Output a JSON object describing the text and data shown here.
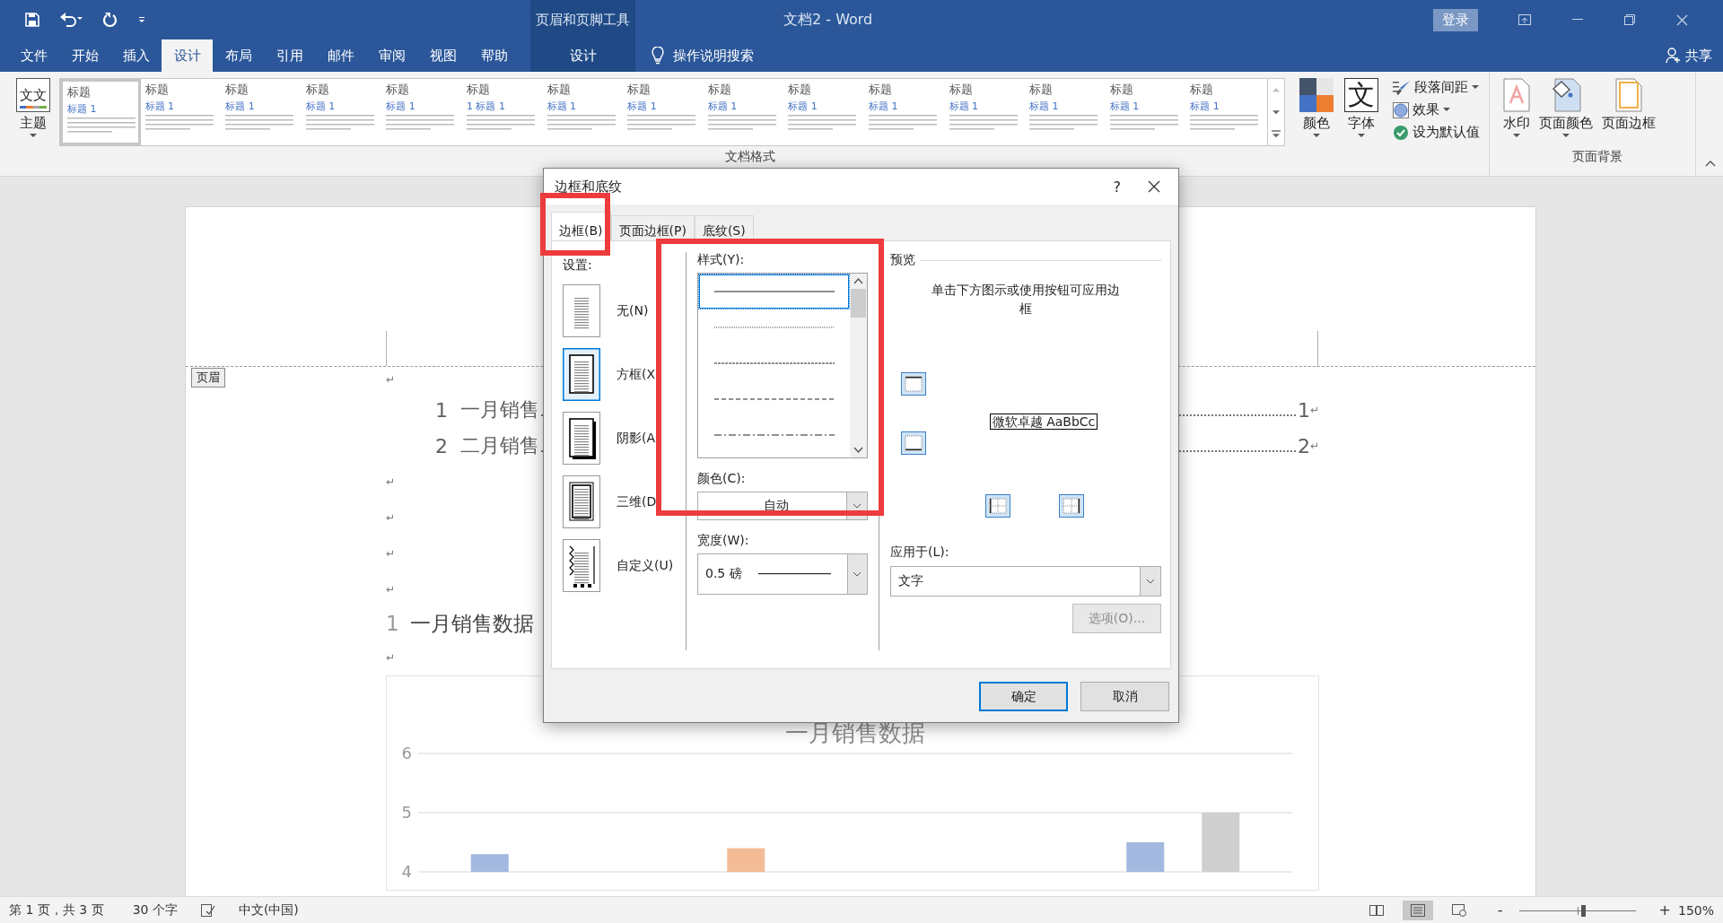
{
  "window": {
    "title": "文档2 - Word",
    "context_group": "页眉和页脚工具",
    "signin": "登录"
  },
  "tabs": [
    {
      "label": "文件",
      "selected": false
    },
    {
      "label": "开始",
      "selected": false
    },
    {
      "label": "插入",
      "selected": false
    },
    {
      "label": "设计",
      "selected": true
    },
    {
      "label": "布局",
      "selected": false
    },
    {
      "label": "引用",
      "selected": false
    },
    {
      "label": "邮件",
      "selected": false
    },
    {
      "label": "审阅",
      "selected": false
    },
    {
      "label": "视图",
      "selected": false
    },
    {
      "label": "帮助",
      "selected": false
    }
  ],
  "context_tabs": [
    {
      "label": "设计",
      "selected": false
    }
  ],
  "search": "操作说明搜索",
  "share": "共享",
  "ribbon": {
    "theme": {
      "label": "主题",
      "icon_text": "文文",
      "dropdown": true
    },
    "gallery": [
      {
        "title": "标题",
        "subtitle": "标题 1",
        "selected": true
      },
      {
        "title": "标题",
        "subtitle": "标题 1",
        "selected": false
      },
      {
        "title": "标题",
        "subtitle": "标题 1",
        "selected": false
      },
      {
        "title": "标题",
        "subtitle": "标题 1",
        "selected": false
      },
      {
        "title": "标题",
        "subtitle": "标题 1",
        "selected": false
      },
      {
        "title": "标题",
        "subtitle": "1 标题 1",
        "selected": false
      },
      {
        "title": "标题",
        "subtitle": "标题 1",
        "selected": false
      },
      {
        "title": "标题",
        "subtitle": "标题 1",
        "selected": false
      },
      {
        "title": "标题",
        "subtitle": "标题 1",
        "selected": false
      },
      {
        "title": "标题",
        "subtitle": "标题 1",
        "selected": false
      },
      {
        "title": "标题",
        "subtitle": "标题 1",
        "selected": false
      },
      {
        "title": "标题",
        "subtitle": "标题 1",
        "selected": false
      },
      {
        "title": "标题",
        "subtitle": "标题 1",
        "selected": false
      },
      {
        "title": "标题",
        "subtitle": "标题 1",
        "selected": false
      },
      {
        "title": "标题",
        "subtitle": "标题 1",
        "selected": false
      }
    ],
    "format_buttons": [
      {
        "kind": "colors",
        "label": "颜色",
        "dropdown": true
      },
      {
        "kind": "fonts",
        "label": "字体",
        "icon_text": "文",
        "dropdown": true
      }
    ],
    "format_options": [
      {
        "kind": "spacing",
        "label": "段落间距",
        "dropdown": true
      },
      {
        "kind": "effects",
        "label": "效果",
        "dropdown": true
      },
      {
        "kind": "default",
        "label": "设为默认值",
        "dropdown": false
      }
    ],
    "format_group": "文档格式",
    "background_buttons": [
      {
        "kind": "watermark",
        "label": "水印",
        "dropdown": true
      },
      {
        "kind": "page-color",
        "label": "页面颜色",
        "dropdown": true
      },
      {
        "kind": "page-border",
        "label": "页面边框",
        "dropdown": false
      }
    ],
    "background_group": "页面背景"
  },
  "document": {
    "header_tag": "页眉",
    "blocks": [
      {
        "kind": "para",
        "mark": "↵"
      },
      {
        "kind": "toc",
        "number": "1",
        "title": "一月销售",
        "page": "1",
        "mark": "↵"
      },
      {
        "kind": "toc",
        "number": "2",
        "title": "二月销售",
        "page": "2",
        "mark": "↵"
      },
      {
        "kind": "para",
        "mark": "↵"
      },
      {
        "kind": "para",
        "mark": "↵"
      },
      {
        "kind": "para",
        "mark": "↵"
      },
      {
        "kind": "para",
        "mark": "↵"
      },
      {
        "kind": "heading",
        "number": "1",
        "text": "一月销售数据"
      },
      {
        "kind": "para",
        "mark": "↵"
      },
      {
        "kind": "chart",
        "chart_data": {
          "type": "bar",
          "title": "一月销售数据",
          "ylim": [
            4,
            6
          ],
          "yticks": [
            4,
            5,
            6
          ],
          "series": [
            {
              "color": "#a3b9e0",
              "values": [
                4.3,
                null,
                null,
                4.5
              ]
            },
            {
              "color": "#f4bc96",
              "values": [
                null,
                4.4,
                null,
                null
              ]
            },
            {
              "color": "#cfcfcf",
              "values": [
                null,
                null,
                null,
                5
              ]
            }
          ]
        }
      }
    ]
  },
  "dialog": {
    "title": "边框和底纹",
    "help": "?",
    "tabs": [
      {
        "label": "边框(B)",
        "selected": true
      },
      {
        "label": "页面边框(P)",
        "selected": false
      },
      {
        "label": "底纹(S)",
        "selected": false
      }
    ],
    "settings_label": "设置:",
    "settings": [
      {
        "kind": "none",
        "label": "无(N)",
        "selected": false
      },
      {
        "kind": "box",
        "label": "方框(X",
        "selected": true
      },
      {
        "kind": "shadow",
        "label": "阴影(A",
        "selected": false
      },
      {
        "kind": "threed",
        "label": "三维(D",
        "selected": false
      },
      {
        "kind": "custom",
        "label": "自定义(U)",
        "selected": false
      }
    ],
    "style_label": "样式(Y):",
    "styles": [
      {
        "kind": "solid",
        "selected": true
      },
      {
        "kind": "dotted",
        "selected": false
      },
      {
        "kind": "fine-dashed",
        "selected": false
      },
      {
        "kind": "dashed",
        "selected": false
      },
      {
        "kind": "dash-dot",
        "selected": false
      }
    ],
    "color_label": "颜色(C):",
    "color_value": "自动",
    "width_label": "宽度(W):",
    "width_value": "0.5 磅",
    "preview_label": "预览",
    "preview_hint": "单击下方图示或使用按钮可应用边框",
    "preview_sample": "微软卓越  AaBbCc",
    "apply_label": "应用于(L):",
    "apply_value": "文字",
    "options_button": {
      "label": "选项(O)...",
      "disabled": true
    },
    "ok": "确定",
    "cancel": "取消"
  },
  "annotations": [
    {
      "kind": "box"
    },
    {
      "kind": "box"
    }
  ],
  "status_bar": {
    "page": "第 1 页，共 3 页",
    "words": "30 个字",
    "language": "中文(中国)",
    "views": [
      {
        "kind": "read",
        "selected": false
      },
      {
        "kind": "print",
        "selected": true
      },
      {
        "kind": "web",
        "selected": false
      }
    ],
    "zoom_out": "-",
    "zoom_in": "+",
    "zoom": {
      "level": 0.55
    },
    "zoom_value": "150%"
  }
}
